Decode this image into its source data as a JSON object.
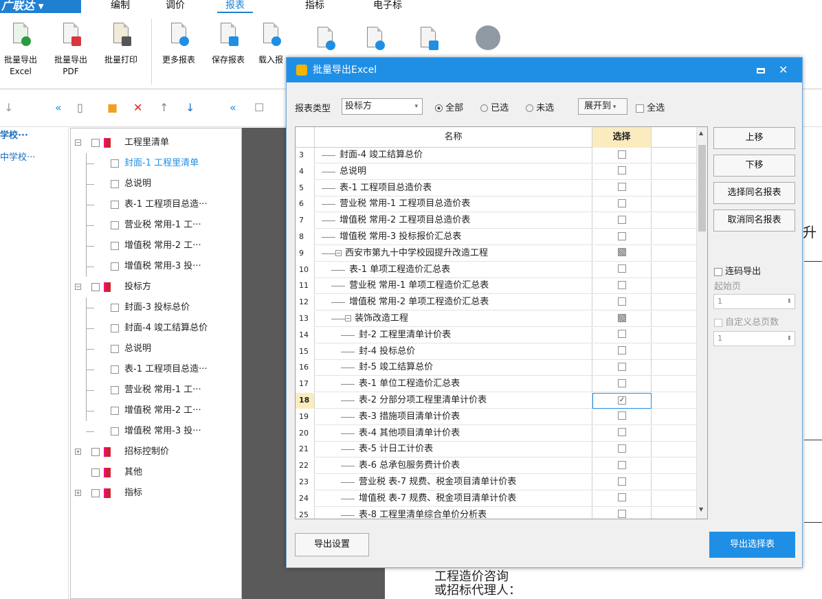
{
  "app": {
    "brand": "广联达",
    "menu": [
      "编制",
      "调价",
      "报表",
      "指标",
      "电子标"
    ],
    "active_menu": "报表"
  },
  "ribbon": {
    "buttons": [
      {
        "label": "批量导出\nExcel",
        "icon": "excel-export-icon"
      },
      {
        "label": "批量导出\nPDF",
        "icon": "pdf-export-icon"
      },
      {
        "label": "批量打印",
        "icon": "print-icon"
      },
      {
        "label": "更多报表",
        "icon": "more-reports-icon"
      },
      {
        "label": "保存报表",
        "icon": "save-report-icon"
      },
      {
        "label": "载入报",
        "icon": "load-report-icon"
      }
    ]
  },
  "left_nav": [
    "学校···",
    "中学校···"
  ],
  "tree": [
    {
      "label": "工程里清单",
      "level": 0,
      "exp": "⊟",
      "book": true
    },
    {
      "label": "封面-1 工程里清单",
      "level": 1,
      "sel": true
    },
    {
      "label": "总说明",
      "level": 1
    },
    {
      "label": "表-1 工程项目总造···",
      "level": 1
    },
    {
      "label": "营业税 常用-1 工···",
      "level": 1
    },
    {
      "label": "增值税 常用-2 工···",
      "level": 1
    },
    {
      "label": "增值税 常用-3 投···",
      "level": 1
    },
    {
      "label": "投标方",
      "level": 0,
      "exp": "⊟",
      "book": true
    },
    {
      "label": "封面-3 投标总价",
      "level": 1
    },
    {
      "label": "封面-4 竣工结算总价",
      "level": 1
    },
    {
      "label": "总说明",
      "level": 1
    },
    {
      "label": "表-1 工程项目总造···",
      "level": 1
    },
    {
      "label": "营业税 常用-1 工···",
      "level": 1
    },
    {
      "label": "增值税 常用-2 工···",
      "level": 1
    },
    {
      "label": "增值税 常用-3 投···",
      "level": 1
    },
    {
      "label": "招标控制价",
      "level": 0,
      "exp": "⊞",
      "book": true
    },
    {
      "label": "其他",
      "level": 0,
      "book": true
    },
    {
      "label": "指标",
      "level": 0,
      "exp": "⊞",
      "book": true
    }
  ],
  "doc": {
    "right_text": "升",
    "bottom_line1": "工程造价咨询",
    "bottom_line2": "或招标代理人："
  },
  "dialog": {
    "title": "批量导出Excel",
    "report_type_label": "报表类型",
    "report_type_value": "投标方",
    "radio_all": "全部",
    "radio_selected": "已选",
    "radio_unselected": "未选",
    "expand_label": "展开到",
    "select_all": "全选",
    "col_name": "名称",
    "col_select": "选择",
    "rows": [
      {
        "n": "3",
        "name": "封面-4 竣工结算总价",
        "indent": 1,
        "state": "none"
      },
      {
        "n": "4",
        "name": "总说明",
        "indent": 1,
        "state": "none"
      },
      {
        "n": "5",
        "name": "表-1 工程项目总造价表",
        "indent": 1,
        "state": "none"
      },
      {
        "n": "6",
        "name": "营业税 常用-1 工程项目总造价表",
        "indent": 1,
        "state": "none"
      },
      {
        "n": "7",
        "name": "增值税 常用-2 工程项目总造价表",
        "indent": 1,
        "state": "none"
      },
      {
        "n": "8",
        "name": "增值税 常用-3 投标报价汇总表",
        "indent": 1,
        "state": "none"
      },
      {
        "n": "9",
        "name": "西安市第九十中学校园提升改造工程",
        "indent": 1,
        "state": "partial",
        "exp": "⊟"
      },
      {
        "n": "10",
        "name": "表-1 单项工程造价汇总表",
        "indent": 2,
        "state": "none"
      },
      {
        "n": "11",
        "name": "营业税 常用-1 单项工程造价汇总表",
        "indent": 2,
        "state": "none"
      },
      {
        "n": "12",
        "name": "增值税 常用-2 单项工程造价汇总表",
        "indent": 2,
        "state": "none"
      },
      {
        "n": "13",
        "name": "装饰改造工程",
        "indent": 2,
        "state": "partial",
        "exp": "⊟"
      },
      {
        "n": "14",
        "name": "封-2 工程里清单计价表",
        "indent": 3,
        "state": "none"
      },
      {
        "n": "15",
        "name": "封-4 投标总价",
        "indent": 3,
        "state": "none"
      },
      {
        "n": "16",
        "name": "封-5 竣工结算总价",
        "indent": 3,
        "state": "none"
      },
      {
        "n": "17",
        "name": "表-1 单位工程造价汇总表",
        "indent": 3,
        "state": "none"
      },
      {
        "n": "18",
        "name": "表-2 分部分项工程里清单计价表",
        "indent": 3,
        "state": "checked",
        "current": true
      },
      {
        "n": "19",
        "name": "表-3 措施项目清单计价表",
        "indent": 3,
        "state": "none"
      },
      {
        "n": "20",
        "name": "表-4 其他项目清单计价表",
        "indent": 3,
        "state": "none"
      },
      {
        "n": "21",
        "name": "表-5 计日工计价表",
        "indent": 3,
        "state": "none"
      },
      {
        "n": "22",
        "name": "表-6 总承包服务费计价表",
        "indent": 3,
        "state": "none"
      },
      {
        "n": "23",
        "name": "营业税 表-7 规费、税金项目清单计价表",
        "indent": 3,
        "state": "none"
      },
      {
        "n": "24",
        "name": "增值税 表-7 规费、税金项目清单计价表",
        "indent": 3,
        "state": "none"
      },
      {
        "n": "25",
        "name": "表-8 工程里清单综合单价分析表",
        "indent": 3,
        "state": "none"
      }
    ],
    "btn_up": "上移",
    "btn_down": "下移",
    "btn_select_same": "选择同名报表",
    "btn_cancel_same": "取消同名报表",
    "continuous_label": "连码导出",
    "start_page_label": "起始页",
    "start_page": "1",
    "custom_total_label": "自定义总页数",
    "custom_total": "1",
    "btn_export_settings": "导出设置",
    "btn_export_selected": "导出选择表"
  },
  "colors": {
    "accent": "#1f8fe6",
    "brand": "#1f7fd1"
  }
}
